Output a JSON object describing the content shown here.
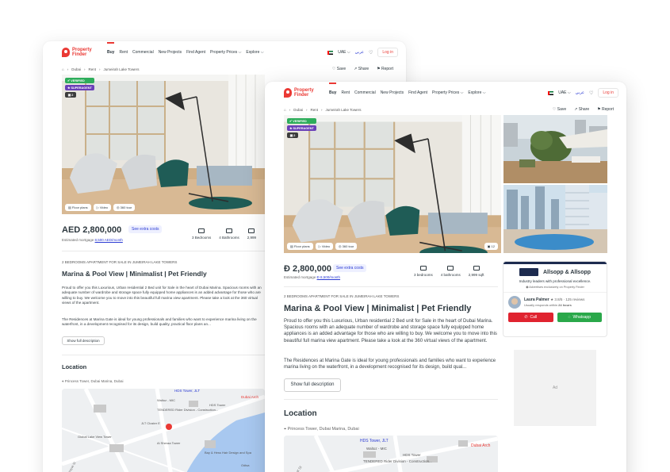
{
  "logo": {
    "line1": "Property",
    "line2": "Finder"
  },
  "nav": {
    "items": [
      "Buy",
      "Rent",
      "Commercial",
      "New Projects",
      "Find Agent",
      "Property Prices ⌵",
      "Explore ⌵"
    ],
    "country": "UAE ⌵",
    "language": "عربي",
    "login": "Log in"
  },
  "breadcrumb": {
    "items": [
      "Dubai",
      "Rent",
      "Jumeirah Lake Towers"
    ],
    "separator": "›"
  },
  "actions": {
    "save": "Save",
    "share": "Share",
    "report": "Report"
  },
  "badges": {
    "verified": "VERIFIED",
    "superagent": "SUPERAGENT",
    "count": "2"
  },
  "photo_tools": {
    "floor_plans": "Floor plans",
    "video": "Video",
    "tour": "360 tour",
    "photo_count": "12"
  },
  "back": {
    "price": "AED 2,800,000",
    "extra_costs": "See extra costs",
    "mortgage_label": "Estimated mortgage",
    "mortgage_value": "8,500 AED/month",
    "bedrooms": "3 Bedrooms",
    "bathrooms": "4 Bathrooms",
    "size": "2,999",
    "kicker": "2 BEDROOMS APARTMENT FOR SALE IN JUMEIRAH LAKE TOWERS",
    "title": "Marina & Pool View | Minimalist | Pet Friendly",
    "desc1": "Proud to offer you this Luxurious, Urban residential 2 Bed unit for Sale in the heart of Dubai Marina. Spacious rooms with an adequate number of wardrobe and storage space fully equipped home appliances is an added advantage for those who are willing to buy. We welcome you to move into this beautiful full marina view apartment. Please take a look at the 360 virtual views of the apartment.",
    "desc2": "The Residences at Marina Gate is ideal for young professionals and families who want to experience marina living on the waterfront, in a development recognised for its design, build quality, practical floor plans an...",
    "show_full": "Show full description",
    "location": "Location",
    "address": "Princess Tower, Dubai Marina, Dubai"
  },
  "front": {
    "price_symbol": "Ð",
    "price_value": "2,800,000",
    "extra_costs": "See extra costs",
    "mortgage_label": "Estimated mortgage",
    "mortgage_value": "Ð 8,500/month",
    "bedrooms": "3 bedrooms",
    "bathrooms": "4 bathrooms",
    "size": "2,999 sqft",
    "kicker": "2 BEDROOMS APARTMENT FOR SALE IN JUMEIRAH LAKE TOWERS",
    "title": "Marina & Pool View | Minimalist | Pet Friendly",
    "desc1": "Proud to offer you this Luxurious, Urban residential 2 Bed unit for Sale in the heart of Dubai Marina. Spacious rooms with an adequate number of wardrobe and storage space fully equipped home appliances is an added advantage for those who are willing to buy. We welcome you to move into this beautiful full marina view apartment. Please take a look at the 360 virtual views of the apartment.",
    "desc2": "The Residences at Marina Gate is ideal for young professionals and families who want to experience marina living on the waterfront, in a development recognised for its design, build qual...",
    "show_full": "Show full description",
    "location": "Location",
    "address": "Princess Tower, Dubai Marina, Dubai"
  },
  "agent": {
    "agency": "Allsopp & Allsopp",
    "tagline": "Industry leaders with professional excellence.",
    "exclusive": "Advertises exclusively on Property Finder",
    "name": "Laura Palmer",
    "rating": "★ 3.8/5 · 125 reviews",
    "responds_prefix": "Usually responds within",
    "responds_time": "24 hours",
    "call": "Call",
    "whatsapp": "Whatsapp"
  },
  "ad": "Ad",
  "map": {
    "labels": {
      "hds": "HDS Tower, JLT",
      "dubai_arch": "Dubai Arch",
      "waltoz": "Waltoz - MIC",
      "hds_tower": "HDS Tower",
      "tendered": "TENDERED Rider Division - Construction...",
      "jlt_cluster": "JLT Cluster E",
      "global_lake": "Global Lake View Tower",
      "sheraton": "Al Sheraa Tower",
      "saba": "Saba Towers",
      "emirates_hills": "Emirates Hills Drive...",
      "golf": "Bay & Hess Hair Design and Spa",
      "gold_crest": "Gold Crest Views",
      "street": "Al Sarayat St",
      "ob": "Odisa"
    }
  },
  "colors": {
    "brand": "#ea3934",
    "link": "#2b3bd3",
    "call": "#e0232f",
    "whatsapp": "#2aa84a"
  }
}
